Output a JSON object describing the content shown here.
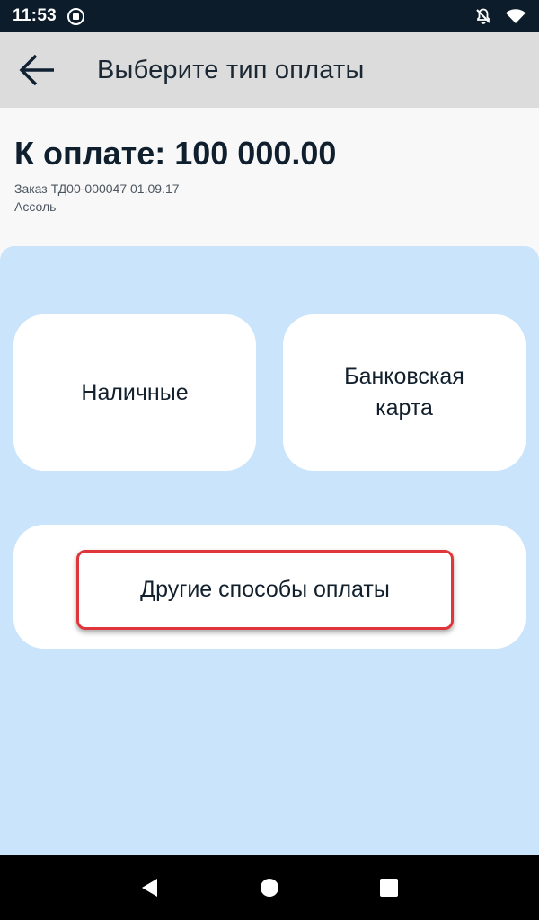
{
  "status_bar": {
    "time": "11:53",
    "icons": [
      "app-notification-icon",
      "notifications-off-icon",
      "wifi-icon"
    ]
  },
  "app_bar": {
    "back_icon": "arrow-back-icon",
    "title": "Выберите тип оплаты"
  },
  "summary": {
    "amount_text": "К оплате: 100 000.00",
    "order_text": "Заказ ТД00-000047 01.09.17",
    "customer_text": "Ассоль"
  },
  "payment_options": {
    "cash_label": "Наличные",
    "bank_card_label": "Банковская карта",
    "other_label": "Другие способы оплаты"
  },
  "colors": {
    "status_bar": "#0c1c2b",
    "app_bar": "#dcdcdc",
    "panel": "#c9e4fb",
    "card": "#ffffff",
    "highlight": "#e0353b",
    "nav_bar": "#000000"
  },
  "nav_bar": {
    "icons": [
      "back-triangle-icon",
      "home-circle-icon",
      "recents-square-icon"
    ]
  }
}
